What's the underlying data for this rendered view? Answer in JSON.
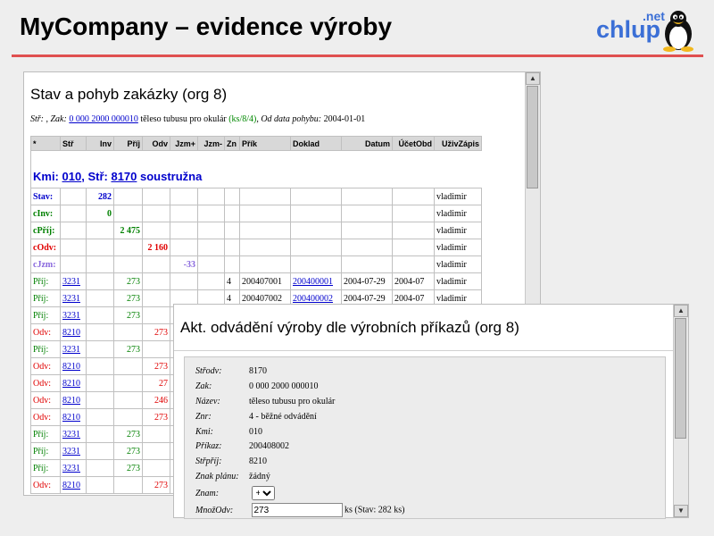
{
  "header": {
    "title": "MyCompany – evidence výroby",
    "logo_net": ".net",
    "logo_text": "chlup"
  },
  "win1": {
    "title": "Stav a pohyb zakázky (org 8)",
    "sub": {
      "str_label": "Stř:",
      "str_value": ",",
      "zak_label": "Zak:",
      "zak_value": "0 000 2000 000010",
      "desc": "těleso tubusu pro okulár",
      "code": "(ks/8/4)",
      "od_label": "Od data pohybu:",
      "od_value": "2004-01-01"
    },
    "columns": [
      "*",
      "Stř",
      "Inv",
      "Příj",
      "Odv",
      "Jzm+",
      "Jzm-",
      "Zn",
      "Přík",
      "Doklad",
      "Datum",
      "ÚčetObd",
      "UživZápis"
    ],
    "kmi": {
      "prefix": "Kmi:",
      "kmi_value": "010",
      "str_prefix": ", Stř:",
      "str_value": "8170",
      "name": "soustružna"
    },
    "summary_rows": [
      {
        "label": "Stav:",
        "inv": "282",
        "user": "vladimir"
      },
      {
        "label": "cInv:",
        "inv": "0",
        "user": "vladimir"
      },
      {
        "label": "cPříj:",
        "prij": "2 475",
        "user": "vladimir"
      },
      {
        "label": "cOdv:",
        "odv": "2 160",
        "user": "vladimir"
      },
      {
        "label": "cJzm:",
        "jzm": "-33",
        "user": "vladimir"
      }
    ],
    "rows": [
      {
        "type": "Příj:",
        "str": "3231",
        "prij": "273",
        "odv": "",
        "zn": "4",
        "prik": "200407001",
        "doklad": "200400001",
        "datum": "2004-07-29",
        "ucet": "2004-07",
        "user": "vladimir"
      },
      {
        "type": "Příj:",
        "str": "3231",
        "prij": "273",
        "odv": "",
        "zn": "4",
        "prik": "200407002",
        "doklad": "200400002",
        "datum": "2004-07-29",
        "ucet": "2004-07",
        "user": "vladimir"
      },
      {
        "type": "Příj:",
        "str": "3231",
        "prij": "273",
        "odv": ""
      },
      {
        "type": "Odv:",
        "str": "8210",
        "prij": "",
        "odv": "273"
      },
      {
        "type": "Příj:",
        "str": "3231",
        "prij": "273",
        "odv": ""
      },
      {
        "type": "Odv:",
        "str": "8210",
        "prij": "",
        "odv": "273"
      },
      {
        "type": "Odv:",
        "str": "8210",
        "prij": "",
        "odv": "27"
      },
      {
        "type": "Odv:",
        "str": "8210",
        "prij": "",
        "odv": "246"
      },
      {
        "type": "Odv:",
        "str": "8210",
        "prij": "",
        "odv": "273"
      },
      {
        "type": "Příj:",
        "str": "3231",
        "prij": "273",
        "odv": ""
      },
      {
        "type": "Příj:",
        "str": "3231",
        "prij": "273",
        "odv": ""
      },
      {
        "type": "Příj:",
        "str": "3231",
        "prij": "273",
        "odv": ""
      },
      {
        "type": "Odv:",
        "str": "8210",
        "prij": "",
        "odv": "273"
      }
    ]
  },
  "win2": {
    "title": "Akt. odvádění výroby dle výrobních příkazů (org 8)",
    "fields": [
      {
        "label": "Střodv:",
        "value": "8170"
      },
      {
        "label": "Zak:",
        "value": "0 000 2000 000010"
      },
      {
        "label": "Název:",
        "value": "těleso tubusu pro okulár"
      },
      {
        "label": "Znr:",
        "value": "4 - běžné odvádění"
      },
      {
        "label": "Kmi:",
        "value": "010"
      },
      {
        "label": "Příkaz:",
        "value": "200408002"
      },
      {
        "label": "Střpříj:",
        "value": "8210"
      },
      {
        "label": "Znak plánu:",
        "value": "žádný"
      }
    ],
    "znam": {
      "label": "Znam:",
      "selected": "+"
    },
    "mnozodv": {
      "label": "MnožOdv:",
      "value": "273",
      "suffix": "ks (Stav: 282 ks)"
    }
  },
  "colors": {
    "prij": "#008000",
    "odv": "#e00000",
    "stav": "#0000cc",
    "jzm": "#8866dd",
    "link": "#0000cc",
    "accent_line": "#e05050",
    "logo": "#3b6fd6"
  }
}
